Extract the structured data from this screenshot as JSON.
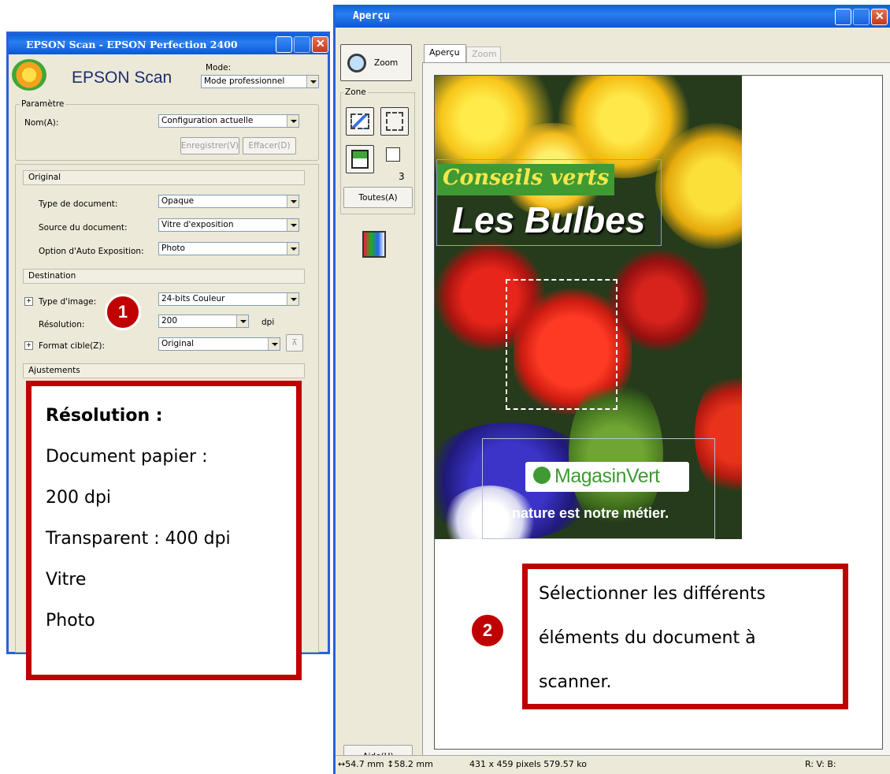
{
  "epson": {
    "title": "EPSON Scan - EPSON Perfection 2400",
    "logo_text": "EPSON Scan",
    "mode_label": "Mode:",
    "mode_value": "Mode professionnel",
    "param_group": "Paramètre",
    "name_label": "Nom(A):",
    "name_value": "Configuration actuelle",
    "save_button": "Enregistrer(V)",
    "delete_button": "Effacer(D)",
    "original_section": "Original",
    "doc_type_label": "Type de document:",
    "doc_type_value": "Opaque",
    "doc_source_label": "Source du document:",
    "doc_source_value": "Vitre d'exposition",
    "auto_exp_label": "Option d'Auto Exposition:",
    "auto_exp_value": "Photo",
    "destination_section": "Destination",
    "image_type_label": "Type d'image:",
    "image_type_value": "24-bits Couleur",
    "resolution_label": "Résolution:",
    "resolution_value": "200",
    "resolution_unit": "dpi",
    "format_label": "Format cible(Z):",
    "format_value": "Original",
    "adjust_section": "Ajustements"
  },
  "preview": {
    "title": "Aperçu",
    "zoom_button": "Zoom",
    "zone_group": "Zone",
    "zone_count": "3",
    "all_button": "Toutes(A)",
    "help_button": "Aide(H)",
    "tab_preview": "Aperçu",
    "tab_zoom": "Zoom",
    "status_dims": "54.7 mm",
    "status_dims2": "58.2 mm",
    "status_pixels": "431 x 459 pixels 579.57 ko",
    "status_rgb": "R:  V:  B:"
  },
  "poster": {
    "subtitle": "Conseils verts",
    "title": "Les Bulbes",
    "brand": "MagasinVert",
    "slogan": "La nature est notre métier."
  },
  "callout1": {
    "badge": "1",
    "heading": "Résolution :",
    "lines": [
      "Document papier :",
      "200 dpi",
      "Transparent : 400 dpi",
      "Vitre",
      "Photo"
    ]
  },
  "callout2": {
    "badge": "2",
    "lines": [
      "Sélectionner les différents",
      "éléments du document à",
      "scanner."
    ]
  },
  "colors": {
    "accent": "#c00000",
    "xp_blue": "#2762d9"
  }
}
